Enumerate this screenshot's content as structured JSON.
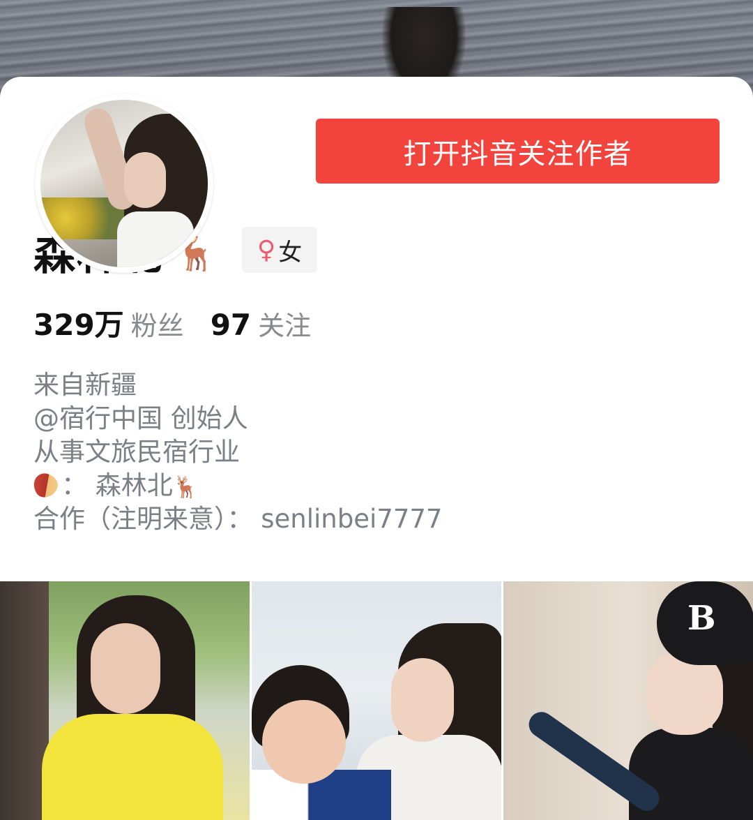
{
  "profile": {
    "follow_button_label": "打开抖音关注作者",
    "name": "森林北",
    "name_emoji": "🦌",
    "gender_symbol": "♀",
    "gender_label": "女",
    "stats": {
      "followers_count": "329万",
      "followers_label": "粉丝",
      "following_count": "97",
      "following_label": "关注"
    },
    "bio": {
      "line1": "来自新疆",
      "line2": "@宿行中国 创始人",
      "line3": "从事文旅民宿行业",
      "line4_text": "： 森林北",
      "line4_emoji": "🦌",
      "line5": "合作（注明来意）： senlinbei7777"
    }
  },
  "thumbnails": {
    "t3_cap_logo": "B"
  },
  "colors": {
    "accent": "#f2433c",
    "female": "#f05a6e",
    "muted_text": "#7c7f86"
  },
  "icons": [
    "deer-icon",
    "female-icon",
    "sweet-potato-icon"
  ]
}
